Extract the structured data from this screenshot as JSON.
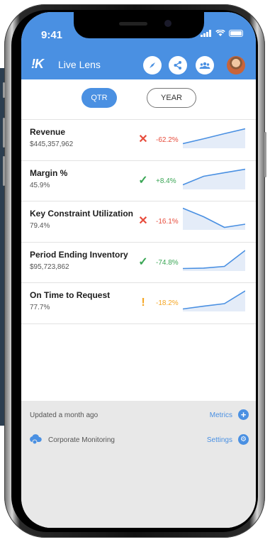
{
  "status_bar": {
    "time": "9:41"
  },
  "header": {
    "logo": "!K",
    "title": "Live Lens"
  },
  "period_toggle": {
    "options": [
      "QTR",
      "YEAR"
    ],
    "selected": "QTR"
  },
  "kpis": [
    {
      "name": "Revenue",
      "value": "$445,357,962",
      "status": "bad",
      "status_icon": "x-icon",
      "change": "-62.2%",
      "trend": [
        0.15,
        0.38,
        0.62,
        0.85
      ]
    },
    {
      "name": "Margin %",
      "value": "45.9%",
      "status": "good",
      "status_icon": "check-icon",
      "change": "+8.4%",
      "trend": [
        0.15,
        0.55,
        0.72,
        0.88
      ]
    },
    {
      "name": "Key Constraint Utilization",
      "value": "79.4%",
      "status": "bad",
      "status_icon": "x-icon",
      "change": "-16.1%",
      "trend": [
        0.95,
        0.55,
        0.05,
        0.2
      ]
    },
    {
      "name": "Period Ending Inventory",
      "value": "$95,723,862",
      "status": "good",
      "status_icon": "check-icon",
      "change": "-74.8%",
      "trend": [
        0.05,
        0.07,
        0.15,
        0.9
      ]
    },
    {
      "name": "On Time to Request",
      "value": "77.7%",
      "status": "warning",
      "status_icon": "exclamation-icon",
      "change": "-18.2%",
      "trend": [
        0.05,
        0.18,
        0.3,
        0.9
      ]
    }
  ],
  "colors": {
    "accent": "#4a90e2",
    "bad": "#e74c3c",
    "good": "#3aa655",
    "warning": "#f5a623",
    "spark_fill": "#e4ecf8",
    "spark_line": "#4a90e2"
  },
  "footer": {
    "updated": "Updated a month ago",
    "metrics_label": "Metrics",
    "monitoring_label": "Corporate Monitoring",
    "settings_label": "Settings"
  }
}
